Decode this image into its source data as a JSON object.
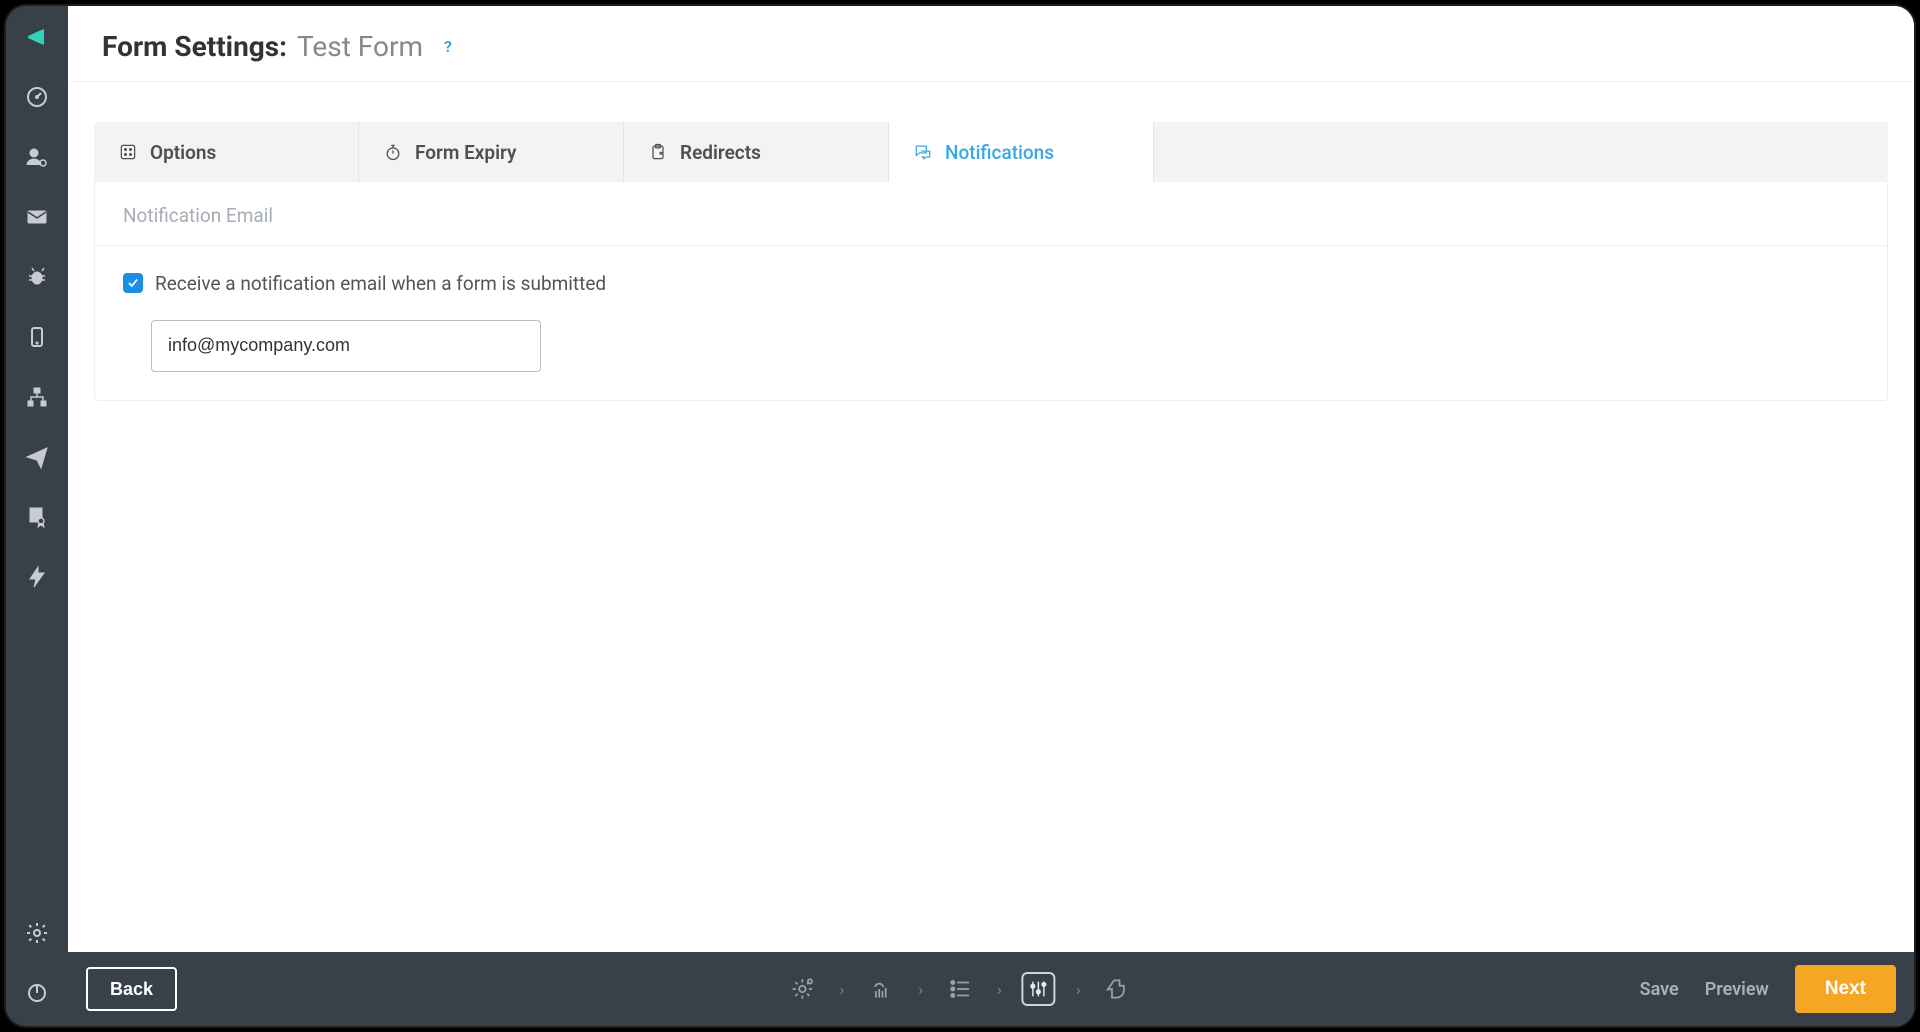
{
  "header": {
    "title_prefix": "Form Settings:",
    "form_name": "Test Form"
  },
  "tabs": [
    {
      "label": "Options"
    },
    {
      "label": "Form Expiry"
    },
    {
      "label": "Redirects"
    },
    {
      "label": "Notifications"
    }
  ],
  "panel": {
    "section_title": "Notification Email",
    "checkbox_label": "Receive a notification email when a form is submitted",
    "email_value": "info@mycompany.com"
  },
  "footer": {
    "back": "Back",
    "save": "Save",
    "preview": "Preview",
    "next": "Next"
  },
  "sidebar": {
    "items": [
      "megaphone",
      "gauge",
      "user-settings",
      "mail",
      "bug",
      "mobile",
      "sitemap",
      "send",
      "certificate",
      "bolt"
    ],
    "bottom": [
      "settings",
      "power"
    ]
  },
  "steps": [
    "gear",
    "hand",
    "list",
    "sliders",
    "thumbs-up"
  ]
}
